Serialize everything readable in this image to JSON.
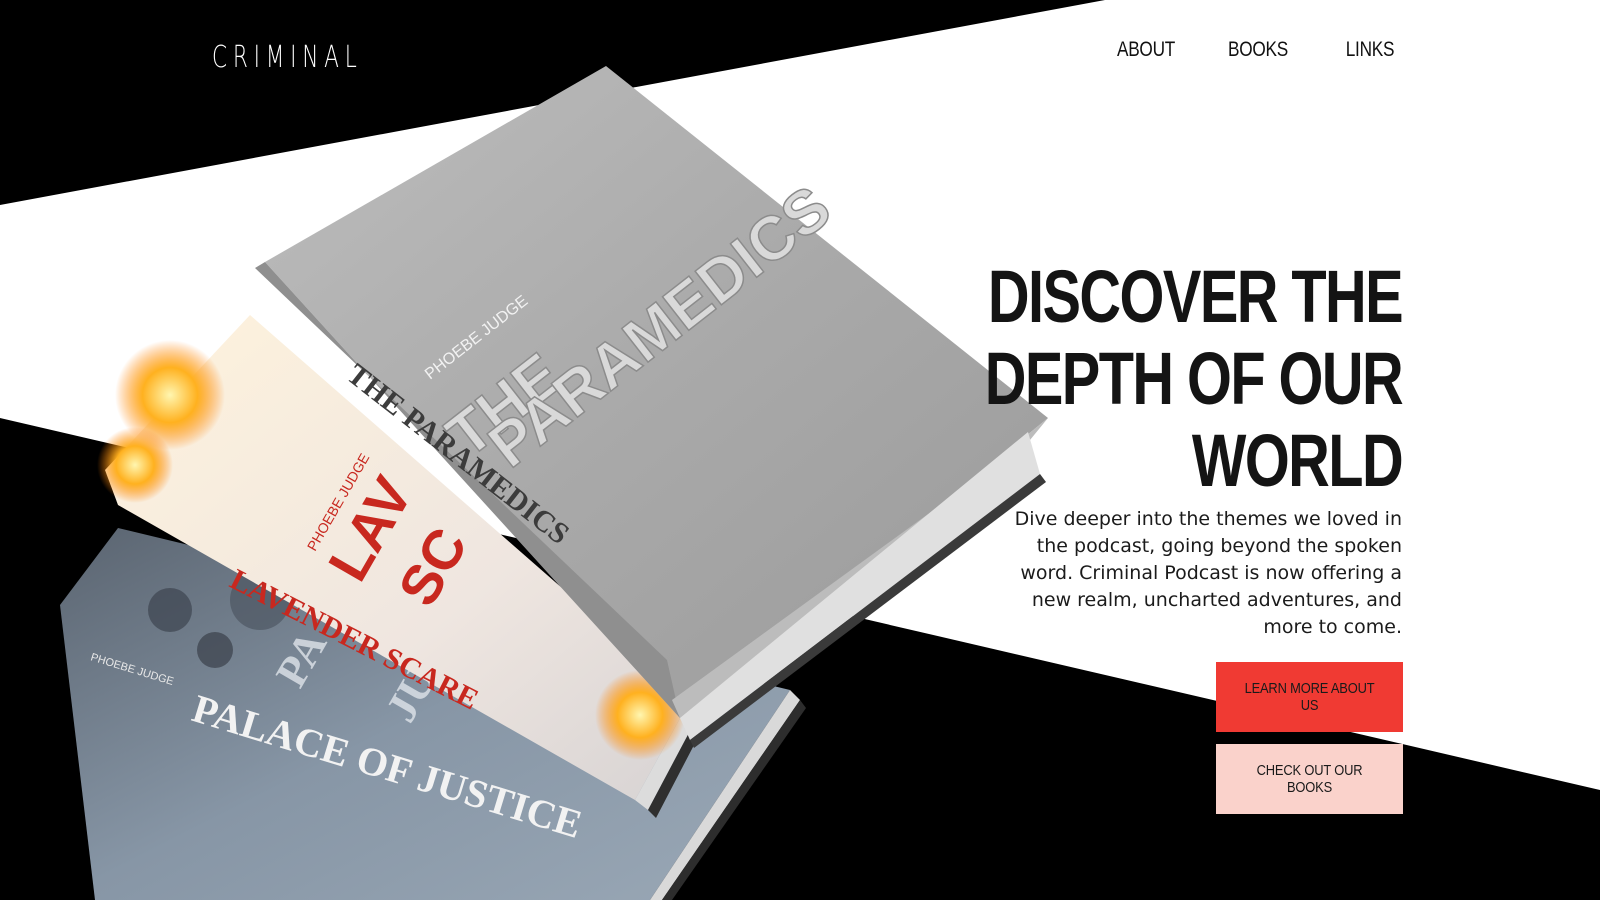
{
  "brand": {
    "logo": "CRIMINAL"
  },
  "nav": {
    "items": [
      "ABOUT",
      "BOOKS",
      "LINKS"
    ]
  },
  "hero": {
    "headline_lines": [
      "DISCOVER THE",
      "DEPTH OF OUR",
      "WORLD"
    ],
    "description": "Dive deeper into the themes we loved in the podcast, going beyond the spoken word. Criminal Podcast is now offering a new realm, uncharted adventures, and more to come.",
    "primary_button": "LEARN MORE ABOUT US",
    "secondary_button": "CHECK OUT OUR BOOKS"
  },
  "books": [
    {
      "author": "PHOEBE JUDGE",
      "title": "THE PARAMEDICS",
      "cover_title_a": "THE",
      "cover_title_b": "PARAMEDICS"
    },
    {
      "author": "PHOEBE JUDGE",
      "title": "LAVENDER SCARE",
      "cover_title_a": "LAV",
      "cover_title_b": "SC"
    },
    {
      "author": "PHOEBE JUDGE",
      "title": "PALACE OF JUSTICE",
      "cover_title_a": "PA",
      "cover_title_b": "JU"
    }
  ],
  "colors": {
    "black": "#000000",
    "white": "#ffffff",
    "accent_red": "#f03a33",
    "accent_pink": "#fad2cb",
    "lavender_red": "#c8281f"
  }
}
